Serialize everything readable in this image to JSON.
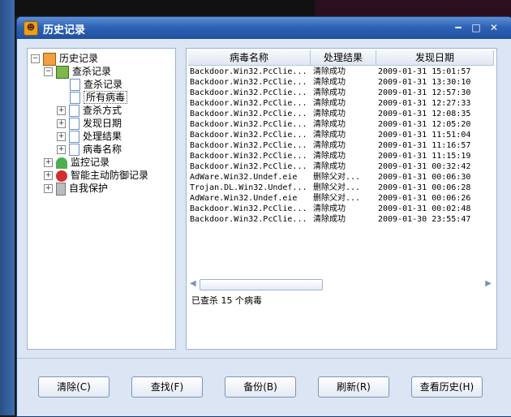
{
  "window": {
    "title": "历史记录"
  },
  "tree": [
    {
      "label": "历史记录"
    },
    {
      "label": "查杀记录"
    },
    {
      "label": "查杀记录"
    },
    {
      "label": "所有病毒"
    },
    {
      "label": "查杀方式"
    },
    {
      "label": "发现日期"
    },
    {
      "label": "处理结果"
    },
    {
      "label": "病毒名称"
    },
    {
      "label": "监控记录"
    },
    {
      "label": "智能主动防御记录"
    },
    {
      "label": "自我保护"
    }
  ],
  "columns": [
    "病毒名称",
    "处理结果",
    "发现日期"
  ],
  "rows": [
    {
      "name": "Backdoor.Win32.PcClie...",
      "result": "清除成功",
      "date": "2009-01-31 15:01:57"
    },
    {
      "name": "Backdoor.Win32.PcClie...",
      "result": "清除成功",
      "date": "2009-01-31 13:30:10"
    },
    {
      "name": "Backdoor.Win32.PcClie...",
      "result": "清除成功",
      "date": "2009-01-31 12:57:30"
    },
    {
      "name": "Backdoor.Win32.PcClie...",
      "result": "清除成功",
      "date": "2009-01-31 12:27:33"
    },
    {
      "name": "Backdoor.Win32.PcClie...",
      "result": "清除成功",
      "date": "2009-01-31 12:08:35"
    },
    {
      "name": "Backdoor.Win32.PcClie...",
      "result": "清除成功",
      "date": "2009-01-31 12:05:20"
    },
    {
      "name": "Backdoor.Win32.PcClie...",
      "result": "清除成功",
      "date": "2009-01-31 11:51:04"
    },
    {
      "name": "Backdoor.Win32.PcClie...",
      "result": "清除成功",
      "date": "2009-01-31 11:16:57"
    },
    {
      "name": "Backdoor.Win32.PcClie...",
      "result": "清除成功",
      "date": "2009-01-31 11:15:19"
    },
    {
      "name": "Backdoor.Win32.PcClie...",
      "result": "清除成功",
      "date": "2009-01-31 00:32:42"
    },
    {
      "name": "AdWare.Win32.Undef.eie",
      "result": "删除父对...",
      "date": "2009-01-31 00:06:30"
    },
    {
      "name": "Trojan.DL.Win32.Undef...",
      "result": "删除父对...",
      "date": "2009-01-31 00:06:28"
    },
    {
      "name": "AdWare.Win32.Undef.eie",
      "result": "删除父对...",
      "date": "2009-01-31 00:06:26"
    },
    {
      "name": "Backdoor.Win32.PcClie...",
      "result": "清除成功",
      "date": "2009-01-31 00:02:48"
    },
    {
      "name": "Backdoor.Win32.PcClie...",
      "result": "清除成功",
      "date": "2009-01-30 23:55:47"
    }
  ],
  "status": "已查杀 15 个病毒",
  "buttons": [
    "清除(C)",
    "查找(F)",
    "备份(B)",
    "刷新(R)",
    "查看历史(H)"
  ]
}
